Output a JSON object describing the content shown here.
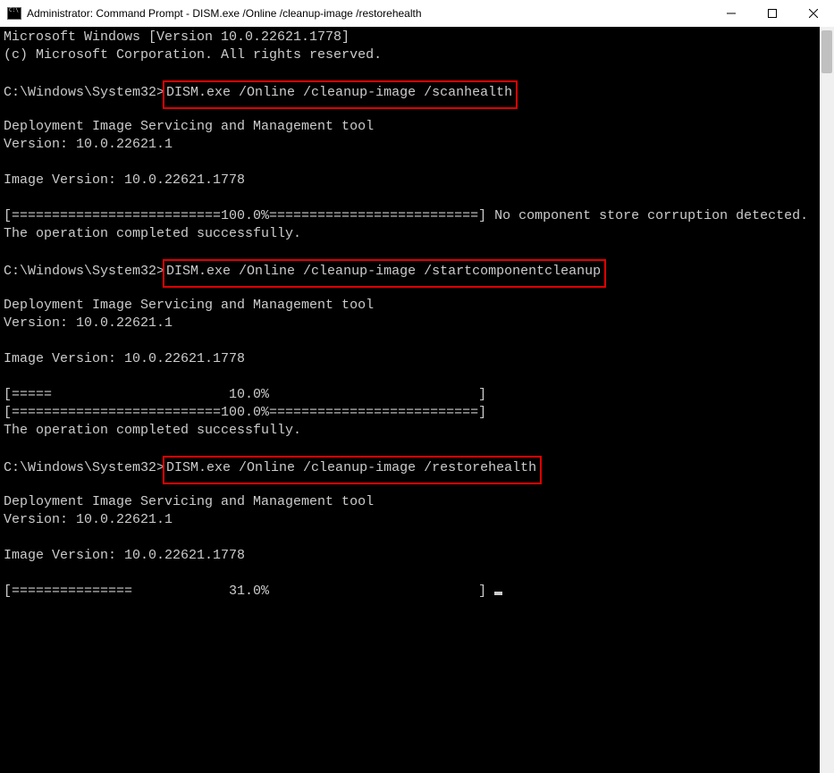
{
  "window": {
    "title": "Administrator: Command Prompt - DISM.exe  /Online /cleanup-image /restorehealth"
  },
  "term": {
    "header1": "Microsoft Windows [Version 10.0.22621.1778]",
    "header2": "(c) Microsoft Corporation. All rights reserved.",
    "prompt": "C:\\Windows\\System32>",
    "cmd1": "DISM.exe /Online /cleanup-image /scanhealth",
    "cmd2": "DISM.exe /Online /cleanup-image /startcomponentcleanup",
    "cmd3": "DISM.exe /Online /cleanup-image /restorehealth",
    "toolName": "Deployment Image Servicing and Management tool",
    "toolVersion": "Version: 10.0.22621.1",
    "imgVersion": "Image Version: 10.0.22621.1778",
    "progress100": "[==========================100.0%==========================] No component store corruption detected.",
    "opComplete": "The operation completed successfully.",
    "progress10": "[=====                      10.0%                          ]",
    "progress100b": "[==========================100.0%==========================]",
    "progress31": "[===============            31.0%                          ] "
  }
}
